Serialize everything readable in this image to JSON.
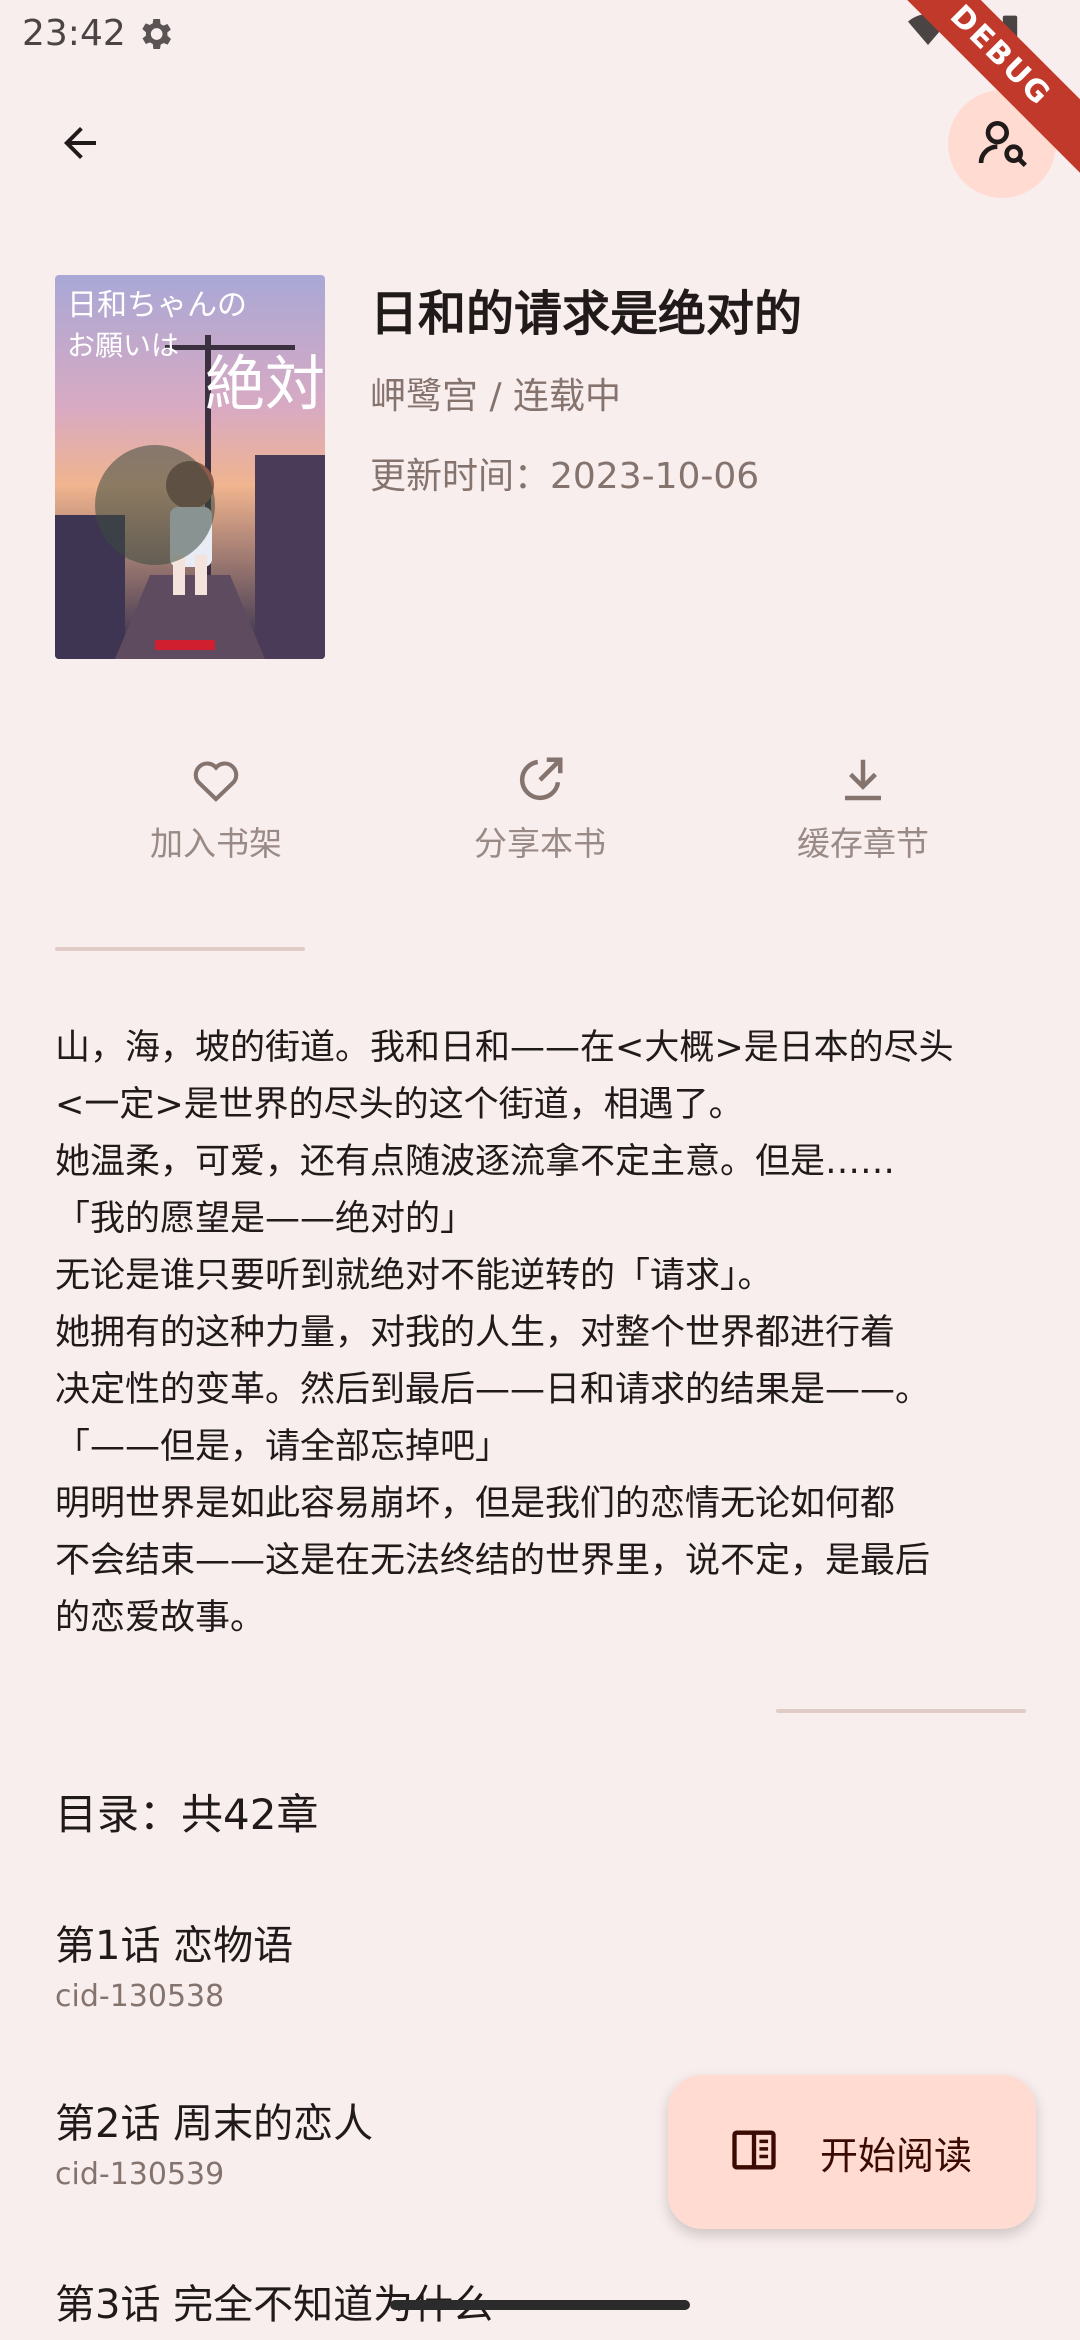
{
  "status_bar": {
    "time": "23:42",
    "icons": [
      "gear-icon",
      "wifi-icon",
      "signal-icon",
      "battery-icon"
    ]
  },
  "debug_ribbon": "DEBUG",
  "toolbar": {
    "back_icon": "arrow-left-icon",
    "profile_icon": "person-search-icon"
  },
  "book": {
    "title": "日和的请求是绝对的",
    "author_status": "岬鹭宫 / 连载中",
    "updated": "更新时间：2023-10-06"
  },
  "actions": [
    {
      "label": "加入书架",
      "icon": "heart-icon"
    },
    {
      "label": "分享本书",
      "icon": "share-icon"
    },
    {
      "label": "缓存章节",
      "icon": "download-icon"
    }
  ],
  "synopsis": "山，海，坡的街道。我和日和——在<大概>是日本的尽头\n<一定>是世界的尽头的这个街道，相遇了。\n她温柔，可爱，还有点随波逐流拿不定主意。但是……\n「我的愿望是——绝对的」\n无论是谁只要听到就绝对不能逆转的「请求」。\n她拥有的这种力量，对我的人生，对整个世界都进行着\n决定性的变革。然后到最后——日和请求的结果是——。\n「——但是，请全部忘掉吧」\n明明世界是如此容易崩坏，但是我们的恋情无论如何都\n不会结束——这是在无法终结的世界里，说不定，是最后\n的恋爱故事。",
  "toc": {
    "title": "目录：共42章",
    "chapters": [
      {
        "title": "第1话 恋物语",
        "cid": "cid-130538"
      },
      {
        "title": "第2话 周末的恋人",
        "cid": "cid-130539"
      },
      {
        "title": "第3话 完全不知道为什么",
        "cid": ""
      }
    ]
  },
  "fab": {
    "label": "开始阅读",
    "icon": "book-open-icon"
  },
  "colors": {
    "background": "#f9eeee",
    "accent_container": "#ffdbd1",
    "secondary_text": "#85736e"
  }
}
